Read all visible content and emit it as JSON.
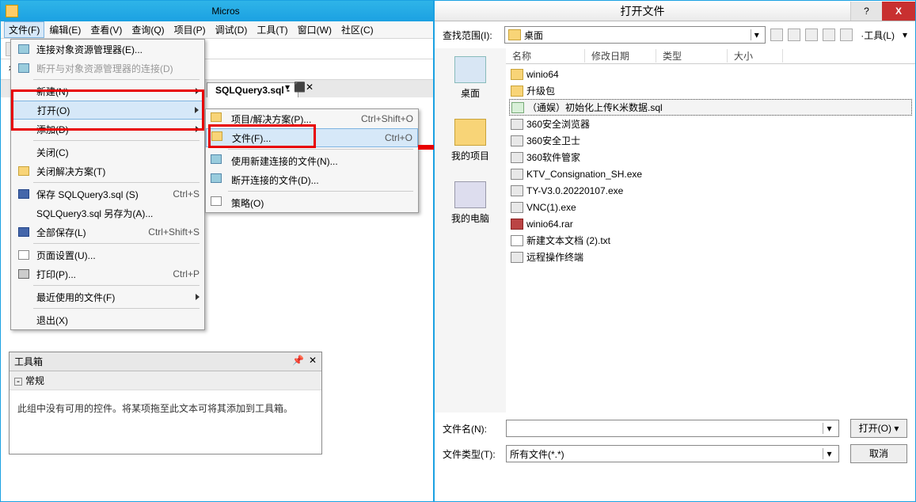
{
  "ssms": {
    "title": "Micros",
    "menubar": [
      "文件(F)",
      "编辑(E)",
      "查看(V)",
      "查询(Q)",
      "项目(P)",
      "调试(D)",
      "工具(T)",
      "窗口(W)",
      "社区(C)"
    ],
    "toolbar2_exec": "行(X)",
    "tab_name": "SQLQuery3.sql -",
    "pin_text": "▾ ⬛ ✕"
  },
  "filemenu": {
    "connect": "连接对象资源管理器(E)...",
    "disconnect": "断开与对象资源管理器的连接(D)",
    "new": "新建(N)",
    "open": "打开(O)",
    "add": "添加(D)",
    "close": "关闭(C)",
    "close_solution": "关闭解决方案(T)",
    "save": "保存 SQLQuery3.sql (S)",
    "save_sc": "Ctrl+S",
    "save_as": "SQLQuery3.sql 另存为(A)...",
    "save_all": "全部保存(L)",
    "save_all_sc": "Ctrl+Shift+S",
    "page_setup": "页面设置(U)...",
    "print": "打印(P)...",
    "print_sc": "Ctrl+P",
    "recent": "最近使用的文件(F)",
    "exit": "退出(X)"
  },
  "submenu": {
    "project": "项目/解决方案(P)...",
    "project_sc": "Ctrl+Shift+O",
    "file": "文件(F)...",
    "file_sc": "Ctrl+O",
    "new_conn": "使用新建连接的文件(N)...",
    "disc_file": "断开连接的文件(D)...",
    "policy": "策略(O)"
  },
  "toolbox": {
    "title": "工具箱",
    "cat": "常规",
    "empty": "此组中没有可用的控件。将某项拖至此文本可将其添加到工具箱。"
  },
  "dialog": {
    "title": "打开文件",
    "look_in_lbl": "查找范围(I):",
    "look_in_val": "桌面",
    "tools_lbl": "·工具(L)",
    "cols": {
      "name": "名称",
      "date": "修改日期",
      "type": "类型",
      "size": "大小"
    },
    "places": {
      "desktop": "桌面",
      "projects": "我的项目",
      "computer": "我的电脑"
    },
    "files": [
      {
        "i": "folder",
        "n": "winio64"
      },
      {
        "i": "folder",
        "n": "升级包"
      },
      {
        "i": "sql",
        "n": "（通娱）初始化上传K米数据.sql",
        "sel": true
      },
      {
        "i": "exe",
        "n": "360安全浏览器"
      },
      {
        "i": "exe",
        "n": "360安全卫士"
      },
      {
        "i": "exe",
        "n": "360软件管家"
      },
      {
        "i": "exe",
        "n": "KTV_Consignation_SH.exe"
      },
      {
        "i": "exe",
        "n": "TY-V3.0.20220107.exe"
      },
      {
        "i": "exe",
        "n": "VNC(1).exe"
      },
      {
        "i": "rar",
        "n": "winio64.rar"
      },
      {
        "i": "txt",
        "n": "新建文本文档 (2).txt"
      },
      {
        "i": "exe",
        "n": "远程操作终端"
      }
    ],
    "filename_lbl": "文件名(N):",
    "filename_val": "",
    "filetype_lbl": "文件类型(T):",
    "filetype_val": "所有文件(*.*)",
    "open_btn": "打开(O)",
    "open_dd": "▾",
    "cancel_btn": "取消"
  }
}
